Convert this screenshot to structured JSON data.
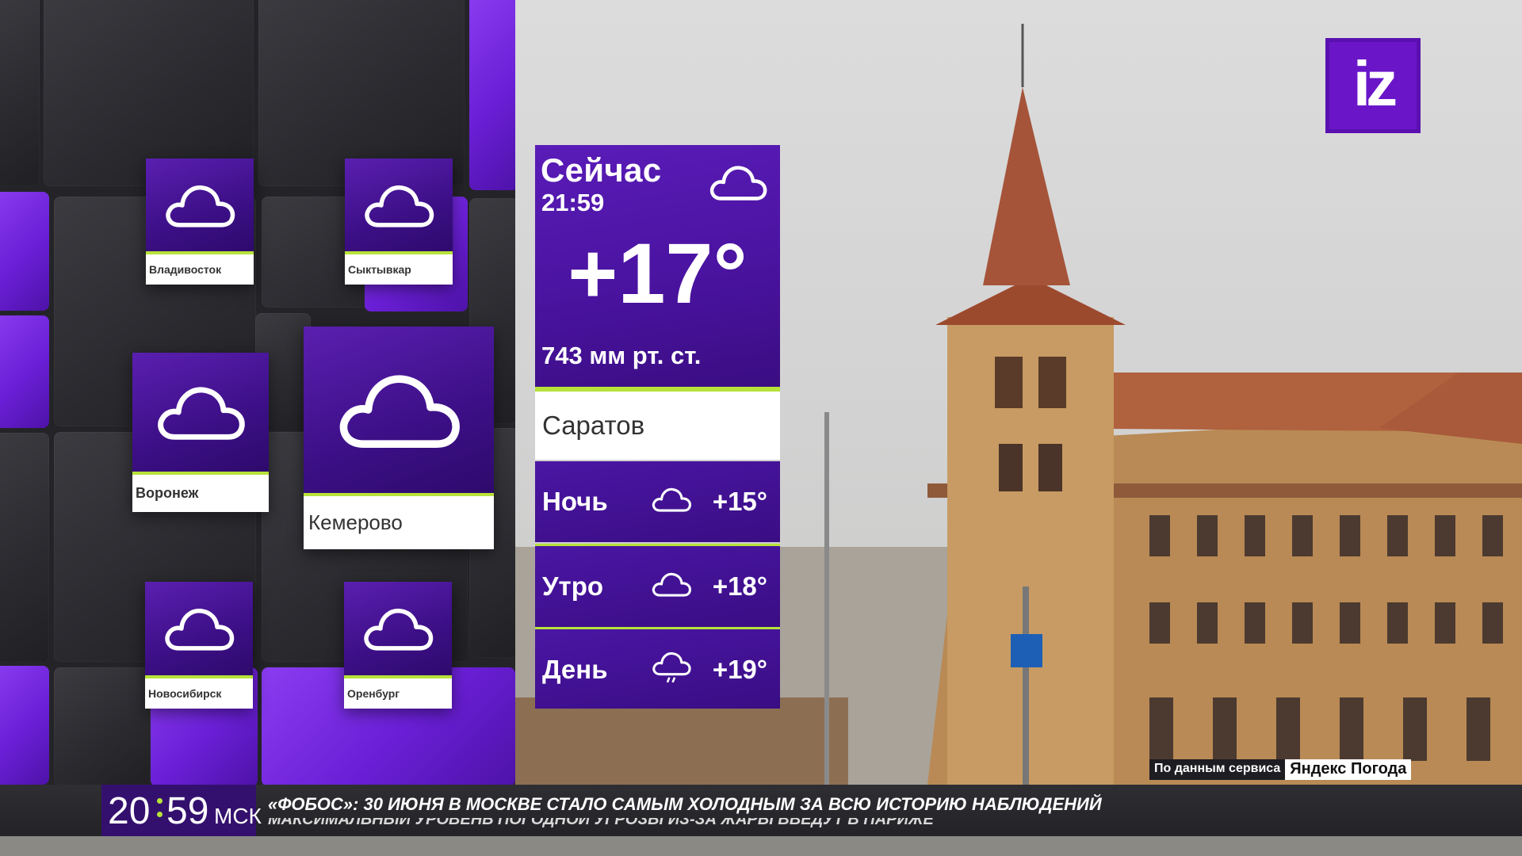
{
  "logo": {
    "text": "iz"
  },
  "current": {
    "title": "Сейчас",
    "time": "21:59",
    "icon": "cloud-icon",
    "temperature": "+17°",
    "pressure": "743 мм рт. ст.",
    "city": "Саратов"
  },
  "forecast": [
    {
      "name": "Ночь",
      "icon": "cloud-icon",
      "temperature": "+15°"
    },
    {
      "name": "Утро",
      "icon": "cloud-icon",
      "temperature": "+18°"
    },
    {
      "name": "День",
      "icon": "cloud-drizzle-icon",
      "temperature": "+19°"
    }
  ],
  "cities": [
    {
      "name": "Владивосток",
      "icon": "cloud-icon"
    },
    {
      "name": "Сыктывкар",
      "icon": "cloud-icon"
    },
    {
      "name": "Воронеж",
      "icon": "cloud-icon"
    },
    {
      "name": "Кемерово",
      "icon": "cloud-icon"
    },
    {
      "name": "Новосибирск",
      "icon": "cloud-icon"
    },
    {
      "name": "Оренбург",
      "icon": "cloud-icon"
    }
  ],
  "source": {
    "prefix": "По данным сервиса",
    "service": "Яндекс Погода"
  },
  "ticker": {
    "clock_hours": "20",
    "clock_minutes": "59",
    "clock_zone": "МСК",
    "headline": "«ФОБОС»: 30 ИЮНЯ В МОСКВЕ СТАЛО САМЫМ ХОЛОДНЫМ ЗА ВСЮ ИСТОРИЮ НАБЛЮДЕНИЙ",
    "headline_next": "МАКСИМАЛЬНЫЙ УРОВЕНЬ ПОГОДНОЙ УГРОЗЫ ИЗ-ЗА ЖАРЫ ВВЕДУТ В ПАРИЖЕ"
  },
  "colors": {
    "accent_purple": "#6a16c8",
    "accent_green": "#b7e23a",
    "panel_purple": "#4a13a0"
  }
}
